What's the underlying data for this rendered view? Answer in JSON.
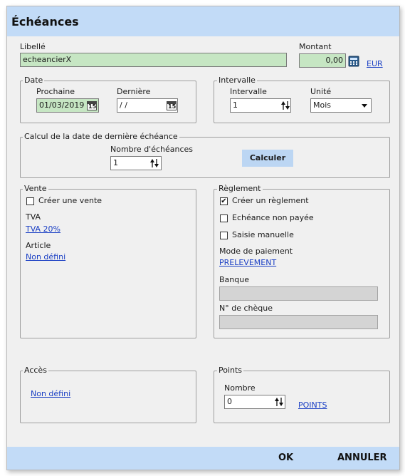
{
  "window": {
    "title": "Échéances"
  },
  "libelle": {
    "label": "Libellé",
    "value": "echeancierX"
  },
  "montant": {
    "label": "Montant",
    "value": "0,00",
    "currency": "EUR"
  },
  "date": {
    "legend": "Date",
    "prochaine_label": "Prochaine",
    "prochaine_value": "01/03/2019",
    "derniere_label": "Dernière",
    "derniere_value": " / /"
  },
  "intervalle": {
    "legend": "Intervalle",
    "intervalle_label": "Intervalle",
    "intervalle_value": "1",
    "unite_label": "Unité",
    "unite_value": "Mois"
  },
  "calcul": {
    "legend": "Calcul de la date de dernière échéance",
    "nombre_label": "Nombre d'échéances",
    "nombre_value": "1",
    "button": "Calculer"
  },
  "vente": {
    "legend": "Vente",
    "creer_label": "Créer une vente",
    "creer_checked": false,
    "tva_label": "TVA",
    "tva_link": "TVA 20%",
    "article_label": "Article",
    "article_link": "Non défini"
  },
  "reglement": {
    "legend": "Règlement",
    "creer_label": "Créer un règlement",
    "creer_checked": true,
    "echeance_label": "Echéance non payée",
    "echeance_checked": false,
    "saisie_label": "Saisie manuelle",
    "saisie_checked": false,
    "mode_label": "Mode de paiement",
    "mode_link": "PRELEVEMENT",
    "banque_label": "Banque",
    "banque_value": "",
    "cheque_label": "N° de chèque",
    "cheque_value": ""
  },
  "acces": {
    "legend": "Accès",
    "link": "Non défini"
  },
  "points": {
    "legend": "Points",
    "nombre_label": "Nombre",
    "nombre_value": "0",
    "link": "POINTS"
  },
  "footer": {
    "ok": "OK",
    "annuler": "ANNULER"
  },
  "icons": {
    "calendar": "calendar-icon",
    "calculator": "calculator-icon",
    "spin": "spin-updown-icon",
    "dropdown": "chevron-down-icon",
    "check": "checkmark-icon"
  },
  "colors": {
    "titlebar": "#c2dbf7",
    "field_green": "#c6e6c3",
    "link": "#1a3fc4",
    "button": "#bcd6f3"
  }
}
